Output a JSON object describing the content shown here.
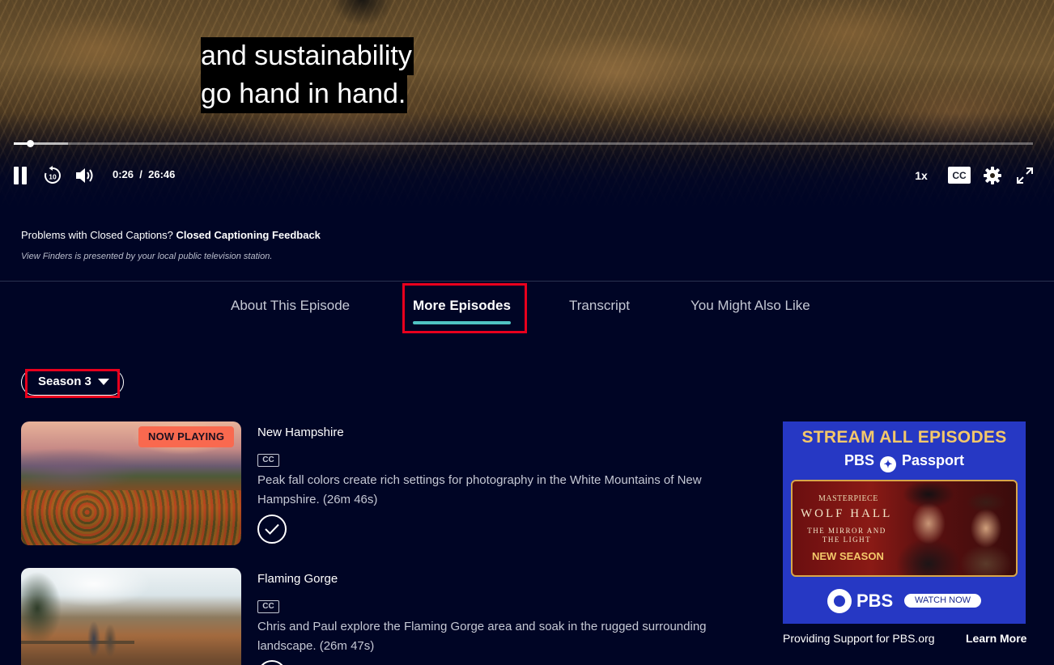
{
  "player": {
    "caption_line1": "and sustainability",
    "caption_line2": "go hand in hand.",
    "current_time": "0:26",
    "duration": "26:46",
    "time_separator": "/",
    "progress_fraction": 0.0162,
    "buffered_fraction": 0.053,
    "speed_label": "1x",
    "cc_label": "CC",
    "replay_label": "10",
    "icons": [
      "pause-icon",
      "replay-10-icon",
      "volume-icon",
      "gear-icon",
      "fullscreen-icon"
    ]
  },
  "info": {
    "cc_question": "Problems with Closed Captions?",
    "cc_feedback_link": "Closed Captioning Feedback",
    "presented_by": "View Finders is presented by your local public television station."
  },
  "tabs": [
    {
      "label": "About This Episode",
      "active": false
    },
    {
      "label": "More Episodes",
      "active": true
    },
    {
      "label": "Transcript",
      "active": false
    },
    {
      "label": "You Might Also Like",
      "active": false
    }
  ],
  "season": {
    "selected": "Season 3"
  },
  "episodes": [
    {
      "title": "New Hampshire",
      "badge": "NOW PLAYING",
      "cc": "CC",
      "description": "Peak fall colors create rich settings for photography in the White Mountains of New Hampshire. (26m 46s)"
    },
    {
      "title": "Flaming Gorge",
      "cc": "CC",
      "description": "Chris and Paul explore the Flaming Gorge area and soak in the rugged surrounding landscape. (26m 47s)"
    }
  ],
  "ad": {
    "headline": "STREAM ALL EPISODES",
    "brand_pre": "PBS",
    "brand_post": "Passport",
    "masterpiece": "MASTERPIECE",
    "show_title": "WOLF HALL",
    "show_subtitle": "THE MIRROR AND THE LIGHT",
    "new_season": "NEW SEASON",
    "pbs_logo_text": "PBS",
    "cta": "WATCH NOW",
    "accent_color": "#f4c86a",
    "background_color": "#2638c4"
  },
  "sponsor": {
    "text": "Providing Support for PBS.org",
    "learn_more": "Learn More"
  },
  "colors": {
    "page_background": "#000525",
    "tab_underline": "#4fc3c3",
    "now_playing_badge": "#f9694f",
    "highlight_box": "#e8001d"
  }
}
